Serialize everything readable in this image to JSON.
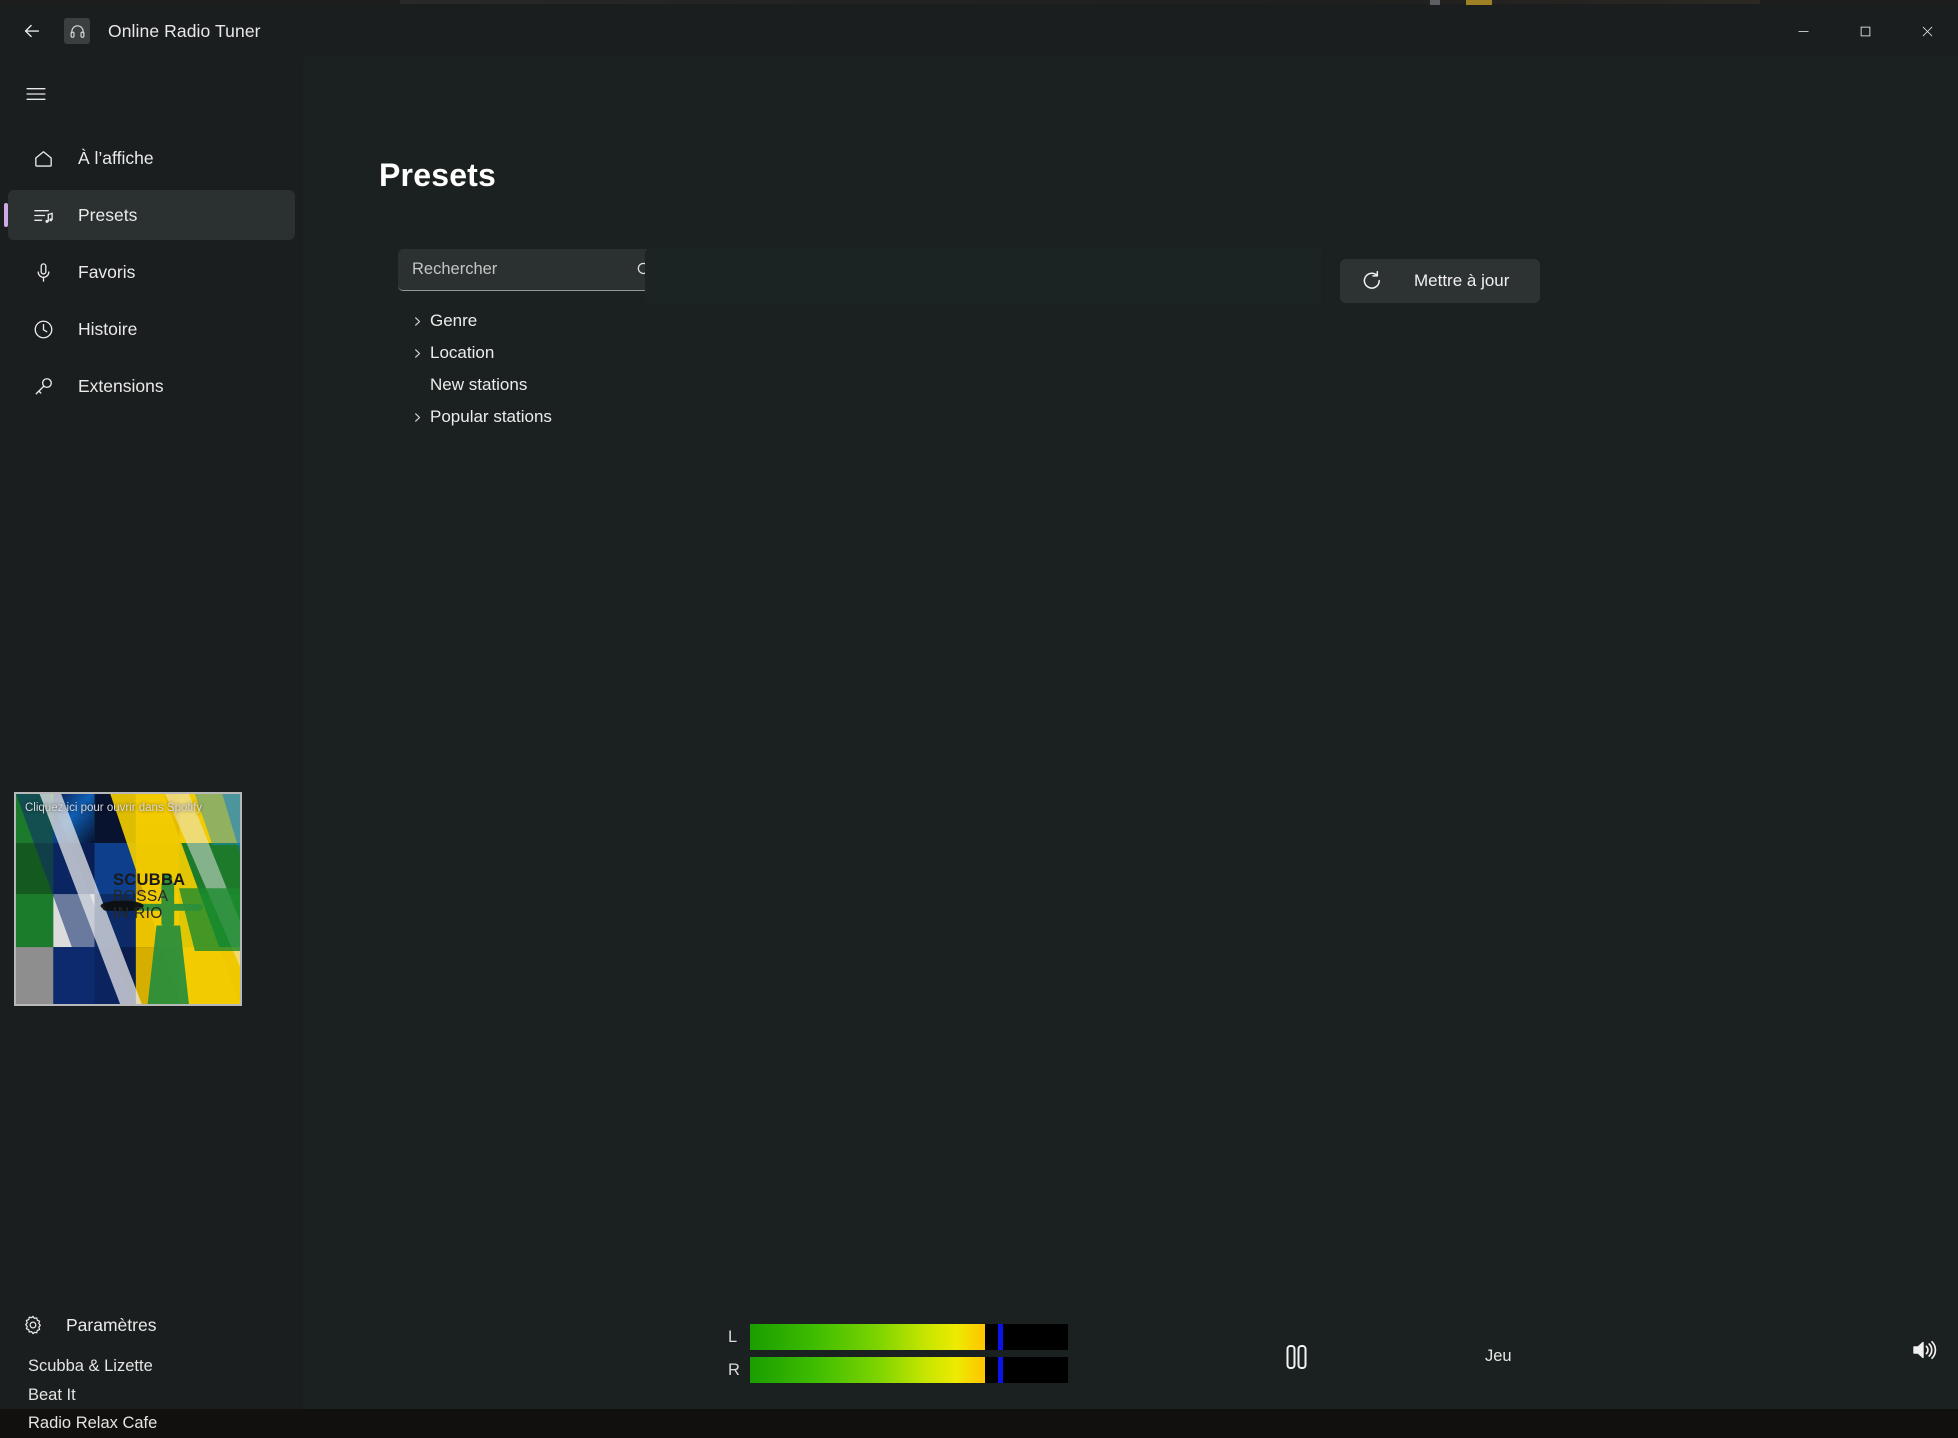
{
  "window": {
    "title": "Online Radio Tuner",
    "app_icon": "headphones-icon",
    "back_icon": "back-arrow-icon",
    "minimize_label": "—",
    "maximize_label": "□",
    "close_label": "✕"
  },
  "sidebar": {
    "menu_icon": "hamburger-menu-icon",
    "items": [
      {
        "label": "À l’affiche",
        "icon": "home-icon",
        "active": false
      },
      {
        "label": "Presets",
        "icon": "playlist-music-icon",
        "active": true
      },
      {
        "label": "Favoris",
        "icon": "microphone-icon",
        "active": false
      },
      {
        "label": "Histoire",
        "icon": "clock-icon",
        "active": false
      },
      {
        "label": "Extensions",
        "icon": "key-icon",
        "active": false
      }
    ],
    "settings": {
      "label": "Paramètres",
      "icon": "gear-icon"
    },
    "album": {
      "overlay_text": "Cliquez ici pour ouvrir dans Spotify",
      "art_line1": "SCUBBA",
      "art_line2": "BOSSA",
      "art_line3": "IN RIO"
    },
    "now_playing": {
      "artist": "Scubba & Lizette",
      "track": "Beat It",
      "station": "Radio Relax Cafe"
    }
  },
  "main": {
    "page_title": "Presets",
    "search": {
      "value": "",
      "placeholder": "Rechercher",
      "icon": "search-icon"
    },
    "tree": [
      {
        "label": "Genre",
        "expandable": true
      },
      {
        "label": "Location",
        "expandable": true
      },
      {
        "label": "New stations",
        "expandable": false
      },
      {
        "label": "Popular stations",
        "expandable": true
      }
    ],
    "update_button": {
      "label": "Mettre à jour",
      "icon": "refresh-icon"
    }
  },
  "transport": {
    "vu_meters": [
      {
        "label": "L",
        "level_pct": 74,
        "peak_pct": 78
      },
      {
        "label": "R",
        "level_pct": 74,
        "peak_pct": 78
      }
    ],
    "play_button": {
      "icon": "pause-icon",
      "state_label": "Jeu"
    },
    "volume": {
      "icon": "volume-high-icon",
      "level_pct": 100
    }
  },
  "colors": {
    "accent": "#cfa8e6",
    "volume_accent": "#e5bdf0",
    "sidebar_bg": "#1a1e1e",
    "content_bg": "#1b2120",
    "active_nav_bg": "#2b3130",
    "vu_peak": "#0b12ea"
  }
}
